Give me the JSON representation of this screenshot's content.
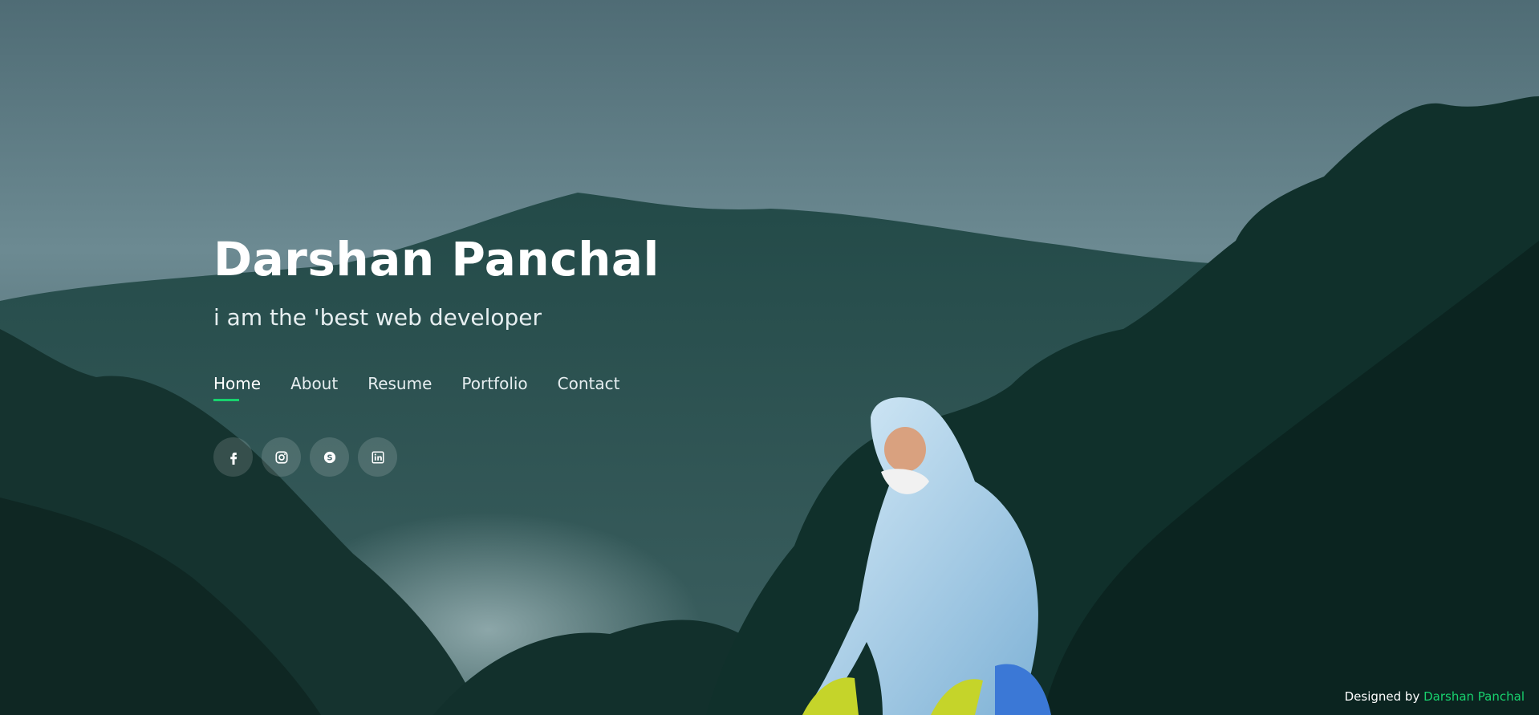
{
  "hero": {
    "name": "Darshan Panchal",
    "tagline": "i am the 'best web developer"
  },
  "nav": {
    "items": [
      {
        "label": "Home",
        "active": true
      },
      {
        "label": "About",
        "active": false
      },
      {
        "label": "Resume",
        "active": false
      },
      {
        "label": "Portfolio",
        "active": false
      },
      {
        "label": "Contact",
        "active": false
      }
    ]
  },
  "social": {
    "items": [
      {
        "icon": "facebook-icon"
      },
      {
        "icon": "instagram-icon"
      },
      {
        "icon": "skype-icon"
      },
      {
        "icon": "linkedin-icon"
      }
    ]
  },
  "footer": {
    "prefix": "Designed by",
    "name": "Darshan Panchal"
  },
  "colors": {
    "accent": "#18d26e",
    "text": "#ffffff"
  }
}
